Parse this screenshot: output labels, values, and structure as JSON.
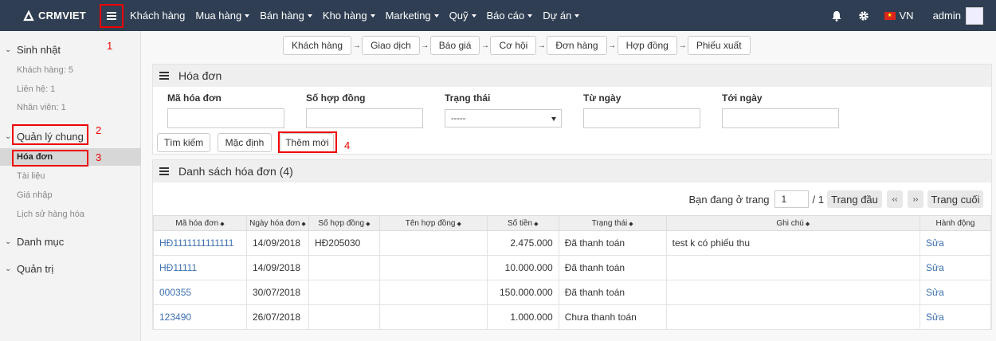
{
  "navbar": {
    "logo": "CRMVIET",
    "menu": [
      {
        "label": "Khách hàng",
        "dropdown": false
      },
      {
        "label": "Mua hàng",
        "dropdown": true
      },
      {
        "label": "Bán hàng",
        "dropdown": true
      },
      {
        "label": "Kho hàng",
        "dropdown": true
      },
      {
        "label": "Marketing",
        "dropdown": true
      },
      {
        "label": "Quỹ",
        "dropdown": true
      },
      {
        "label": "Báo cáo",
        "dropdown": true
      },
      {
        "label": "Dự án",
        "dropdown": true
      }
    ],
    "lang": "VN",
    "user": "admin"
  },
  "sidebar": {
    "birthday": {
      "title": "Sinh nhật",
      "items": [
        "Khách hàng: 5",
        "Liên hệ: 1",
        "Nhân viên: 1"
      ]
    },
    "general": {
      "title": "Quản lý chung",
      "items": [
        "Hóa đơn",
        "Tài liệu",
        "Giá nhập",
        "Lịch sử hàng hóa"
      ]
    },
    "catalog": "Danh mục",
    "admin": "Quản trị"
  },
  "annotations": {
    "m1": "1",
    "m2": "2",
    "m3": "3",
    "m4": "4"
  },
  "flow": [
    "Khách hàng",
    "Giao dịch",
    "Báo giá",
    "Cơ hội",
    "Đơn hàng",
    "Hợp đồng",
    "Phiếu xuất"
  ],
  "filter": {
    "title": "Hóa đơn",
    "invoice_code": "Mã hóa đơn",
    "contract_no": "Số hợp đồng",
    "status": "Trạng thái",
    "status_value": "-----",
    "from_date": "Từ ngày",
    "to_date": "Tới ngày",
    "search_btn": "Tìm kiếm",
    "default_btn": "Mặc định",
    "add_btn": "Thêm mới"
  },
  "list": {
    "title": "Danh sách hóa đơn (4)",
    "pager": {
      "label": "Bạn đang ở trang",
      "page": "1",
      "total": "/ 1",
      "first": "Trang đầu",
      "prev": "‹‹",
      "next": "››",
      "last": "Trang cuối"
    },
    "columns": [
      "Mã hóa đơn",
      "Ngày hóa đơn",
      "Số hợp đồng",
      "Tên hợp đồng",
      "Số tiền",
      "Trạng thái",
      "Ghi chú",
      "Hành động"
    ],
    "rows": [
      {
        "code": "HĐ1111111111111",
        "date": "14/09/2018",
        "contract_no": "HĐ205030",
        "contract_name": "",
        "amount": "2.475.000",
        "status": "Đã thanh toán",
        "note": "test k có phiếu thu",
        "action": "Sửa"
      },
      {
        "code": "HĐ11111",
        "date": "14/09/2018",
        "contract_no": "",
        "contract_name": "",
        "amount": "10.000.000",
        "status": "Đã thanh toán",
        "note": "",
        "action": "Sửa"
      },
      {
        "code": "000355",
        "date": "30/07/2018",
        "contract_no": "",
        "contract_name": "",
        "amount": "150.000.000",
        "status": "Đã thanh toán",
        "note": "",
        "action": "Sửa"
      },
      {
        "code": "123490",
        "date": "26/07/2018",
        "contract_no": "",
        "contract_name": "",
        "amount": "1.000.000",
        "status": "Chưa thanh toán",
        "note": "",
        "action": "Sửa"
      }
    ]
  }
}
